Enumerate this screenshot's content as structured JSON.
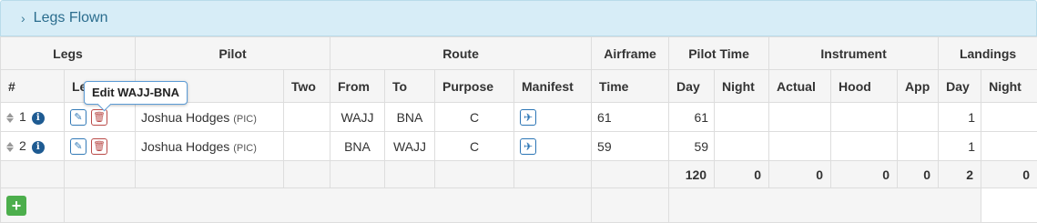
{
  "panel": {
    "title": "Legs Flown",
    "chevron": "›"
  },
  "groups": {
    "legs": "Legs",
    "pilot": "Pilot",
    "route": "Route",
    "airframe": "Airframe",
    "pilot_time": "Pilot Time",
    "instrument": "Instrument",
    "landings": "Landings"
  },
  "columns": {
    "num": "#",
    "legs": "Legs",
    "pilot": "",
    "two": "Two",
    "from": "From",
    "to": "To",
    "purpose": "Purpose",
    "manifest": "Manifest",
    "time": "Time",
    "day": "Day",
    "night": "Night",
    "actual": "Actual",
    "hood": "Hood",
    "app": "App",
    "land_day": "Day",
    "land_night": "Night"
  },
  "rows": [
    {
      "num": "1",
      "pilot": "Joshua Hodges",
      "role": "(PIC)",
      "two": "",
      "from": "WAJJ",
      "to": "BNA",
      "purpose": "C",
      "time": "61",
      "day": "61",
      "night": "",
      "actual": "",
      "hood": "",
      "app": "",
      "land_day": "1",
      "land_night": ""
    },
    {
      "num": "2",
      "pilot": "Joshua Hodges",
      "role": "(PIC)",
      "two": "",
      "from": "BNA",
      "to": "WAJJ",
      "purpose": "C",
      "time": "59",
      "day": "59",
      "night": "",
      "actual": "",
      "hood": "",
      "app": "",
      "land_day": "1",
      "land_night": ""
    }
  ],
  "totals": {
    "day": "120",
    "night": "0",
    "actual": "0",
    "hood": "0",
    "app": "0",
    "land_day": "2",
    "land_night": "0"
  },
  "tooltip": {
    "text": "Edit WAJJ-BNA"
  },
  "icons": {
    "info": "i",
    "edit": "✎",
    "delete": "🗑",
    "plane": "✈",
    "add": "+"
  },
  "colors": {
    "header_bg": "#d7edf7",
    "header_text": "#2b6d8e",
    "add_green": "#4cae4c",
    "delete_red": "#b94a48",
    "edit_blue": "#337ab7"
  }
}
